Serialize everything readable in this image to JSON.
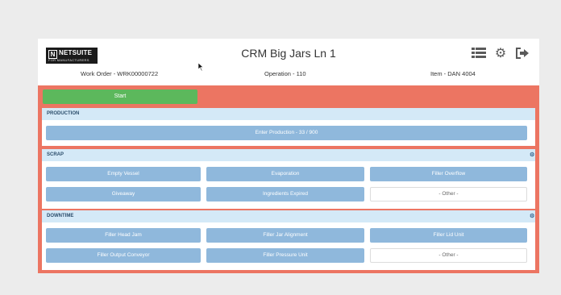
{
  "header": {
    "logo_brand": "NETSUITE",
    "logo_mark": "N",
    "logo_sub": "FOR MANUFACTURERS",
    "title": "CRM Big Jars Ln 1",
    "icons": [
      "list-icon",
      "gear-icon",
      "logout-icon"
    ]
  },
  "meta": {
    "work_order": "Work Order - WRK00000722",
    "operation": "Operation - 110",
    "item": "Item - DAN 4004"
  },
  "actions": {
    "start_label": "Start"
  },
  "production": {
    "title": "PRODUCTION",
    "enter_label": "Enter Production - 33 / 900"
  },
  "scrap": {
    "title": "SCRAP",
    "buttons": [
      "Empty Vessel",
      "Evaporation",
      "Filler Overflow",
      "Giveaway",
      "Ingredients Expired"
    ],
    "other_label": "- Other -"
  },
  "downtime": {
    "title": "DOWNTIME",
    "buttons": [
      "Filler Head Jam",
      "Filler Jar Alignment",
      "Filler Lid Unit",
      "Filler Output Conveyor",
      "Filler Pressure Unit"
    ],
    "other_label": "- Other -"
  },
  "colors": {
    "background": "#ececec",
    "work_area": "#ec7562",
    "start": "#5cb85c",
    "button": "#8fb8dc",
    "panel_header": "#d4e9f7"
  }
}
